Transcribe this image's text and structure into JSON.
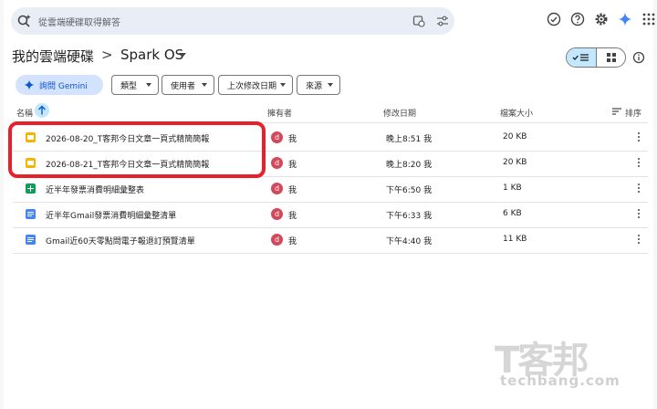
{
  "search": {
    "placeholder": "從雲端硬碟取得解答"
  },
  "breadcrumb": {
    "root": "我的雲端硬碟",
    "separator": ">",
    "current": "Spark OS"
  },
  "filters": {
    "gemini_label": "詢問 Gemini",
    "chips": [
      "類型",
      "使用者",
      "上次修改日期",
      "來源"
    ]
  },
  "table": {
    "headers": {
      "name": "名稱",
      "owner": "擁有者",
      "modified": "修改日期",
      "size": "檔案大小",
      "sort": "排序"
    },
    "rows": [
      {
        "type": "slides",
        "name": "2026-08-20_T客邦今日文章一頁式精簡簡報",
        "avatar": "d",
        "owner": "我",
        "modified": "晚上8:51 我",
        "size": "20 KB"
      },
      {
        "type": "slides",
        "name": "2026-08-21_T客邦今日文章一頁式精簡簡報",
        "avatar": "d",
        "owner": "我",
        "modified": "晚上8:20 我",
        "size": "20 KB"
      },
      {
        "type": "sheets",
        "name": "近半年發票消費明細彙整表",
        "avatar": "d",
        "owner": "我",
        "modified": "下午6:50 我",
        "size": "1 KB"
      },
      {
        "type": "docs",
        "name": "近半年Gmail發票消費明細彙整清單",
        "avatar": "d",
        "owner": "我",
        "modified": "下午6:33 我",
        "size": "6 KB"
      },
      {
        "type": "docs",
        "name": "Gmail近60天零點問電子報退訂預覽清單",
        "avatar": "d",
        "owner": "我",
        "modified": "下午4:40 我",
        "size": "11 KB"
      }
    ]
  },
  "watermark": {
    "title": "T客邦",
    "site": "techbang.com"
  },
  "colors": {
    "accent": "#0b57d0",
    "highlight": "#e8202a",
    "avatar": "#d1495b"
  }
}
